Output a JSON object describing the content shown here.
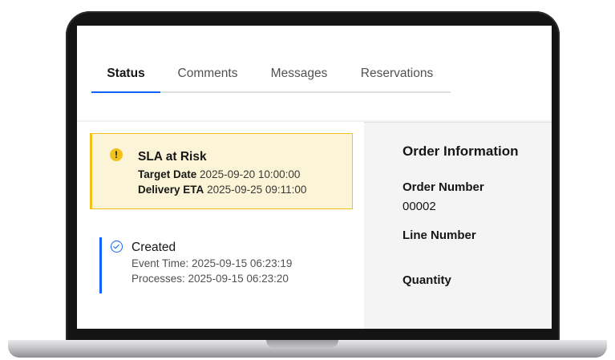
{
  "tabs": [
    {
      "label": "Status",
      "active": true
    },
    {
      "label": "Comments",
      "active": false
    },
    {
      "label": "Messages",
      "active": false
    },
    {
      "label": "Reservations",
      "active": false
    }
  ],
  "sla": {
    "icon": "warning-icon",
    "title": "SLA at Risk",
    "target_label": "Target Date",
    "target_value": "2025-09-20 10:00:00",
    "eta_label": "Delivery ETA",
    "eta_value": "2025-09-25 09:11:00"
  },
  "timeline": {
    "icon": "check-circle-icon",
    "status": "Created",
    "event_time": "Event Time: 2025-09-15 06:23:19",
    "processes": "Processes: 2025-09-15 06:23:20"
  },
  "order_info": {
    "heading": "Order Information",
    "order_number_label": "Order Number",
    "order_number_value": "00002",
    "line_number_label": "Line Number",
    "quantity_label": "Quantity"
  },
  "colors": {
    "accent": "#0f62fe",
    "warning": "#f1c21b",
    "warning_bg": "#fcf4d6",
    "panel_bg": "#f4f4f4"
  }
}
